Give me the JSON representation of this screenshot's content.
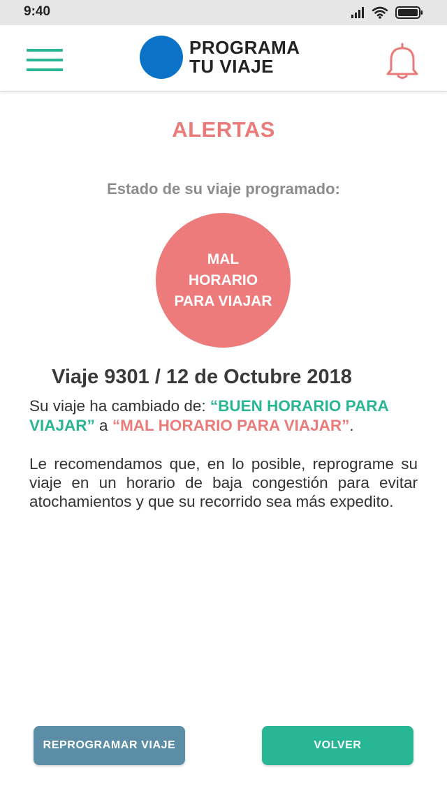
{
  "status_bar": {
    "time": "9:40",
    "icons": [
      "cellular-signal-icon",
      "wifi-icon",
      "battery-icon"
    ]
  },
  "header": {
    "menu_icon": "hamburger-menu-icon",
    "logo": {
      "line1": "PROGRAMA",
      "line2": "TU VIAJE",
      "mark": "blue-circle-logo"
    },
    "notification_icon": "bell-icon"
  },
  "page": {
    "title": "ALERTAS",
    "state_label": "Estado de su viaje programado:",
    "state_value": "MAL HORARIO PARA VIAJAR",
    "trip_heading": "Viaje 9301 / 12 de Octubre 2018",
    "change": {
      "prefix": "Su viaje ha cambiado de: ",
      "from": "“BUEN HORARIO PARA VIAJAR”",
      "connector": " a ",
      "to": "“MAL HORARIO PARA VIAJAR”",
      "suffix": "."
    },
    "recommendation": "Le recomendamos que, en lo posible, reprograme su viaje en un horario de baja congestión para evitar atochamientos y que su recorrido sea más expedito."
  },
  "actions": {
    "reprogram_label": "REPROGRAMAR VIAJE",
    "back_label": "VOLVER"
  },
  "colors": {
    "accent_teal": "#2ab594",
    "alert_coral": "#ea7b7b",
    "logo_blue": "#0a72c7",
    "secondary_button": "#5b8ea6"
  }
}
